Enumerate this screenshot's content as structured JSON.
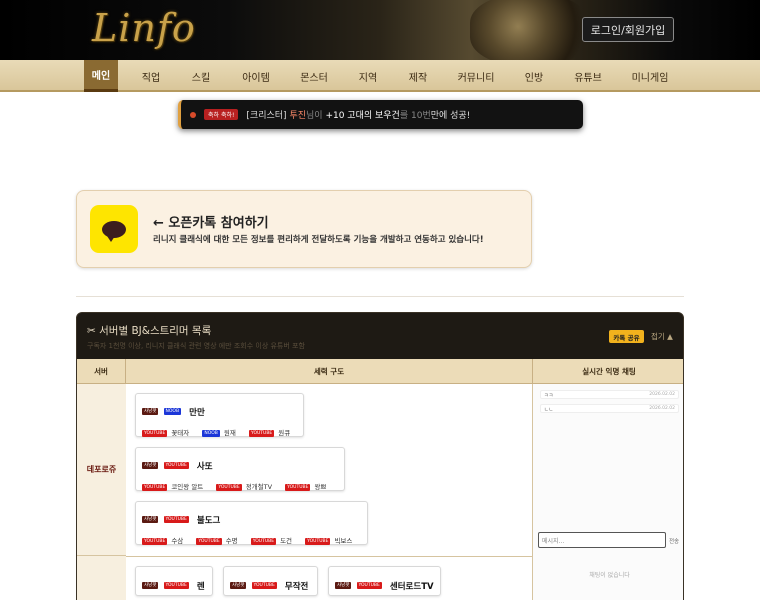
{
  "header": {
    "logo": "Linfo",
    "login_label": "로그인/회원가입"
  },
  "nav": [
    {
      "label": "메인",
      "active": true
    },
    {
      "label": "직업"
    },
    {
      "label": "스킬"
    },
    {
      "label": "아이템"
    },
    {
      "label": "몬스터"
    },
    {
      "label": "지역"
    },
    {
      "label": "제작"
    },
    {
      "label": "커뮤니티"
    },
    {
      "label": "인방"
    },
    {
      "label": "유튜브"
    },
    {
      "label": "미니게임"
    }
  ],
  "ticker": {
    "badge": "축하 축하!",
    "server": "[크리스터]",
    "player": "투진",
    "suffix_nim": "님이",
    "item": "+10 고대의 보우건",
    "particle": "를",
    "dim": "10번",
    "result": "만에 성공!"
  },
  "kakao": {
    "title": "← 오픈카톡 참여하기",
    "subtitle": "리니지 클래식에 대한 모든 정보를 편리하게 전달하도록 기능을 개발하고 연동하고 있습니다!"
  },
  "panel": {
    "title": "✂ 서버별 BJ&스트리머 목록",
    "desc": "구독자 1천명 이상, 리니지 클래식 관련 영상 에만 조회수 이상 유튜버 포함",
    "share_label": "카톡 공유",
    "fold_label": "접기 ▲",
    "columns": {
      "server": "서버",
      "lineup": "세력 구도",
      "chat": "실시간 익명 채팅"
    },
    "servers": [
      {
        "name": "데포로쥬",
        "factions": [
          {
            "leader_tags": [
              {
                "text": "사냥팟",
                "kind": "dark"
              },
              {
                "text": "NOOB",
                "kind": "blue"
              }
            ],
            "leader": "만만",
            "members": [
              {
                "tag": "YOUTUBE",
                "kind": "red",
                "name": "꽃태자"
              },
              {
                "tag": "NOOB",
                "kind": "blue",
                "name": "원재"
              },
              {
                "tag": "YOUTUBE",
                "kind": "red",
                "name": "원큐"
              }
            ]
          },
          {
            "leader_tags": [
              {
                "text": "사냥팟",
                "kind": "dark"
              },
              {
                "text": "YOUTUBE",
                "kind": "red"
              }
            ],
            "leader": "사또",
            "members": [
              {
                "tag": "YOUTUBE",
                "kind": "red",
                "name": "코인왕 알트"
              },
              {
                "tag": "YOUTUBE",
                "kind": "red",
                "name": "정개철TV"
              },
              {
                "tag": "YOUTUBE",
                "kind": "red",
                "name": "왕쁘"
              }
            ]
          },
          {
            "leader_tags": [
              {
                "text": "사냥팟",
                "kind": "dark"
              },
              {
                "text": "YOUTUBE",
                "kind": "red"
              }
            ],
            "leader": "불도그",
            "members": [
              {
                "tag": "YOUTUBE",
                "kind": "red",
                "name": "수삼"
              },
              {
                "tag": "YOUTUBE",
                "kind": "red",
                "name": "수명"
              },
              {
                "tag": "YOUTUBE",
                "kind": "red",
                "name": "도건"
              },
              {
                "tag": "YOUTUBE",
                "kind": "red",
                "name": "빅보스"
              }
            ]
          }
        ]
      },
      {
        "name": "",
        "factions": [
          {
            "leader_tags": [
              {
                "text": "사냥팟",
                "kind": "dark"
              },
              {
                "text": "YOUTUBE",
                "kind": "red"
              }
            ],
            "leader": "렌"
          },
          {
            "leader_tags": [
              {
                "text": "사냥팟",
                "kind": "dark"
              },
              {
                "text": "YOUTUBE",
                "kind": "red"
              }
            ],
            "leader": "무작전"
          },
          {
            "leader_tags": [
              {
                "text": "사냥팟",
                "kind": "dark"
              },
              {
                "text": "YOUTUBE",
                "kind": "red"
              }
            ],
            "leader": "센터로드TV"
          }
        ]
      }
    ],
    "chat": {
      "messages": [
        {
          "text": "ㅋㅋ",
          "time": "2026.02.02"
        },
        {
          "text": "ㄴㄴ",
          "time": "2026.02.02"
        }
      ],
      "input_placeholder": "메시지...",
      "send_label": "전송",
      "empty_text": "채팅이 없습니다"
    }
  }
}
